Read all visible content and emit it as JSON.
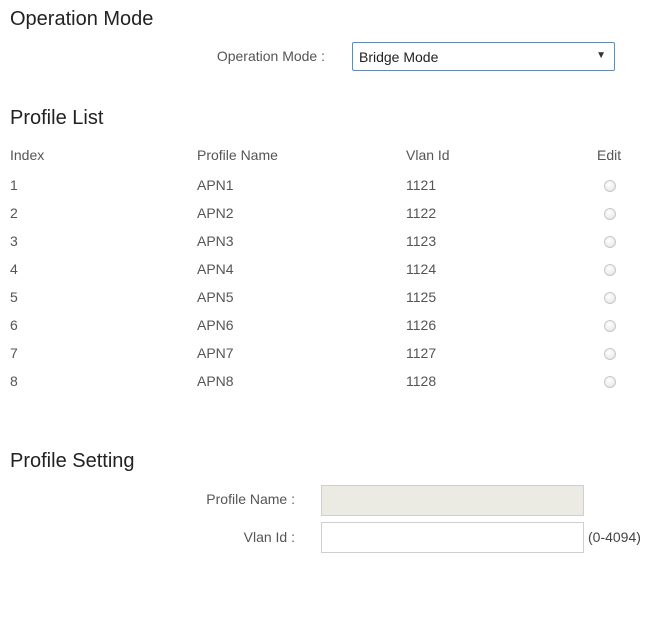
{
  "operation_mode": {
    "section_title": "Operation Mode",
    "field_label": "Operation Mode :",
    "selected_value": "Bridge Mode"
  },
  "profile_list": {
    "section_title": "Profile List",
    "columns": [
      "Index",
      "Profile Name",
      "Vlan Id",
      "Edit"
    ],
    "rows": [
      {
        "index": "1",
        "name": "APN1",
        "vlan": "1121"
      },
      {
        "index": "2",
        "name": "APN2",
        "vlan": "1122"
      },
      {
        "index": "3",
        "name": "APN3",
        "vlan": "1123"
      },
      {
        "index": "4",
        "name": "APN4",
        "vlan": "1124"
      },
      {
        "index": "5",
        "name": "APN5",
        "vlan": "1125"
      },
      {
        "index": "6",
        "name": "APN6",
        "vlan": "1126"
      },
      {
        "index": "7",
        "name": "APN7",
        "vlan": "1127"
      },
      {
        "index": "8",
        "name": "APN8",
        "vlan": "1128"
      }
    ]
  },
  "profile_setting": {
    "section_title": "Profile Setting",
    "profile_name_label": "Profile Name :",
    "profile_name_value": "",
    "vlan_id_label": "Vlan Id :",
    "vlan_id_value": "",
    "vlan_id_hint": "(0-4094)"
  }
}
